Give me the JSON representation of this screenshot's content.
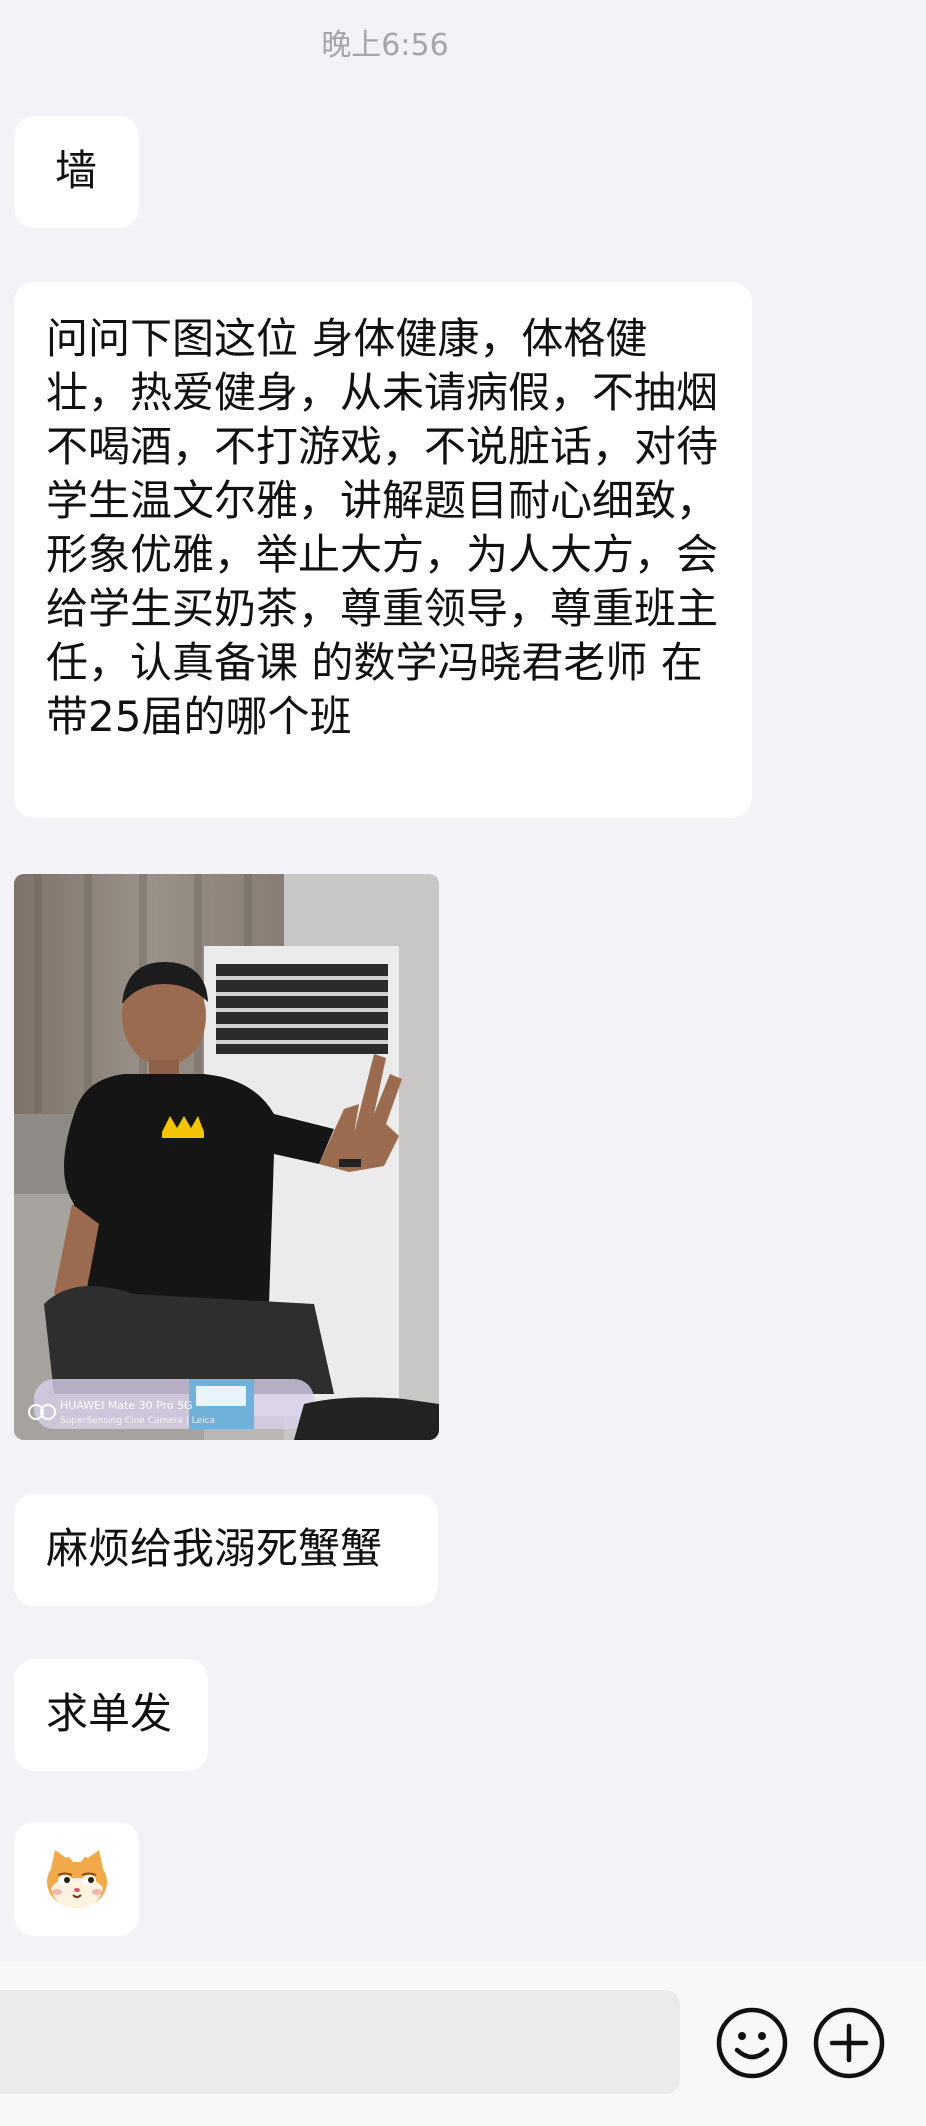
{
  "status": {
    "timestamp": "晚上6:56"
  },
  "messages": [
    {
      "type": "text",
      "text": "墙"
    },
    {
      "type": "text",
      "text": "问问下图这位 身体健康，体格健壮，热爱健身，从未请病假，不抽烟不喝酒，不打游戏，不说脏话，对待学生温文尔雅，讲解题目耐心细致，形象优雅，举止大方，为人大方，会给学生买奶茶，尊重领导，尊重班主任，认真备课 的数学冯晓君老师 在带25届的哪个班"
    },
    {
      "type": "image",
      "watermark_line1": "HUAWEI Mate 30 Pro 5G",
      "watermark_line2": "SuperSensing Cine Camera | Leica"
    },
    {
      "type": "text",
      "text": "麻烦给我溺死蟹蟹"
    },
    {
      "type": "text",
      "text": "求单发"
    },
    {
      "type": "sticker",
      "icon": "hamster-face-icon"
    }
  ],
  "input_bar": {
    "placeholder": "",
    "emoji_icon": "smiley-icon",
    "add_icon": "plus-circle-icon"
  },
  "colors": {
    "background": "#f3f2f7",
    "bubble": "#ffffff",
    "text": "#111111",
    "timestamp": "#a4a4aa",
    "input_bar": "#f8f8f8"
  }
}
